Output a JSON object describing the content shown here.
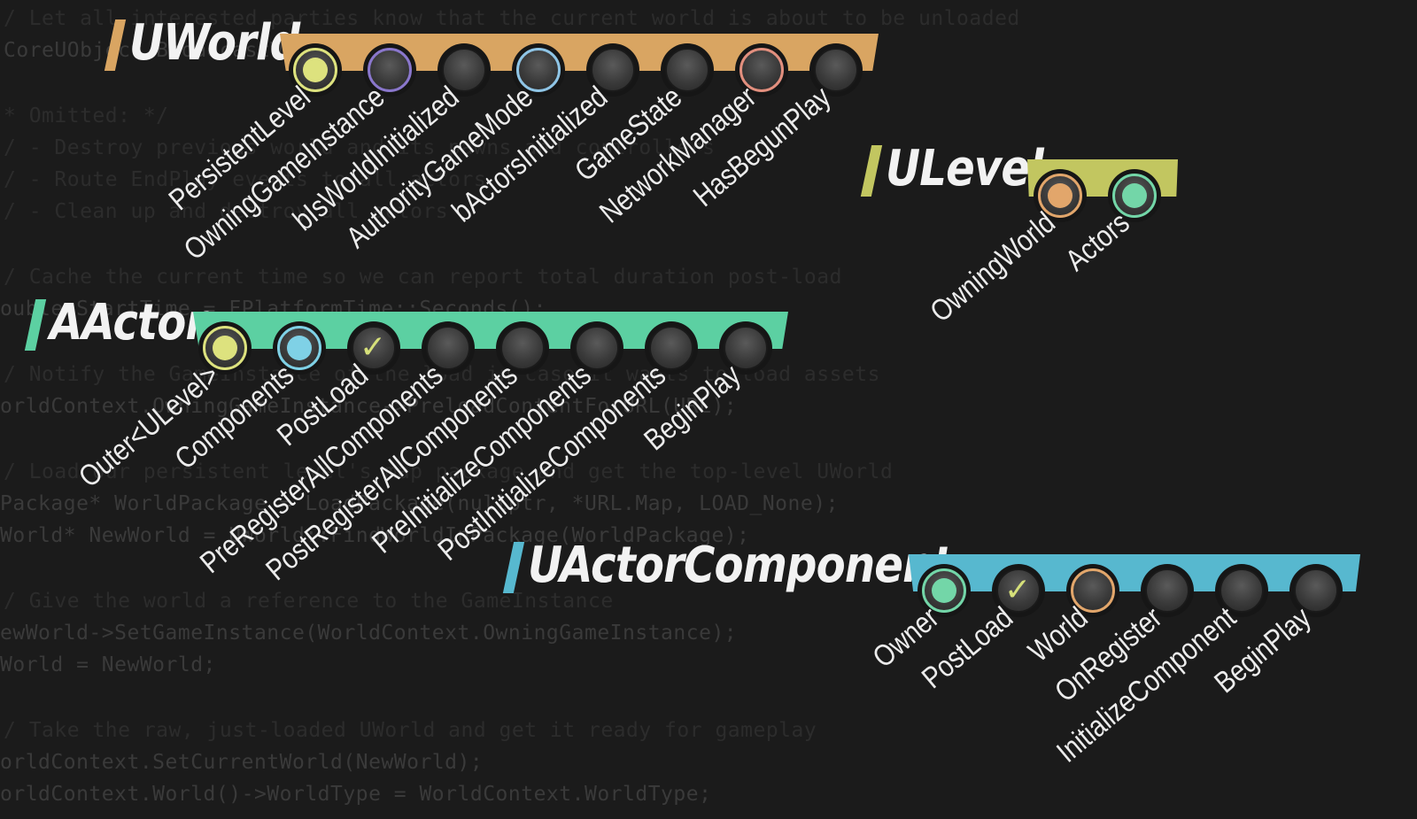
{
  "background_code": [
    "/ Let all interested parties know that the current world is about to be unloaded",
    "CoreUObject.BroadcastWorldCleanup(Map, ...);",
    "* Omitted: */",
    "/ - Destroy previous world and its pawns and controllers",
    "/ - Route EndPlay events to all actors",
    "/ - Clean up and destroy all actors",
    "/ Cache the current time so we can report total duration post-load",
    "ouble StartTime = FPlatformTime::Seconds();",
    "/ Notify the GameInstance of the load in case it wants to load assets",
    "orldContext.OwningGameInstance->PreloadContentForURL(URL);",
    "/ Load our persistent level's map package and get the top-level UWorld",
    "Package* WorldPackage = LoadPackage(nullptr, *URL.Map, LOAD_None);",
    "World* NewWorld = UWorld::FindWorldInPackage(WorldPackage);",
    "/ Give the world a reference to the GameInstance",
    "ewWorld->SetGameInstance(WorldContext.OwningGameInstance);",
    "World = NewWorld;",
    "/ Take the raw, just-loaded UWorld and get it ready for gameplay",
    "orldContext.SetCurrentWorld(NewWorld);",
    "orldContext.World()->WorldType = WorldContext.WorldType;"
  ],
  "colors": {
    "uworld": "#d9a562",
    "ulevel": "#c2c660",
    "aactor": "#5cd0a2",
    "uactorcomponent": "#57b8cf",
    "yellow_fill": "#dde27e",
    "purple_ring": "#8a77cc",
    "blue_ring": "#8fc5e6",
    "salmon_ring": "#e28f7e",
    "orange_fill": "#e2a66b",
    "green_fill": "#73d6a8",
    "cyan_fill": "#7fd1e6",
    "check": "#d6e07a"
  },
  "panels": {
    "uworld": {
      "title": "UWorld",
      "fields": [
        {
          "label": "PersistentLevel",
          "state": "filled",
          "color": "yellow_fill"
        },
        {
          "label": "OwningGameInstance",
          "state": "ring",
          "color": "purple_ring"
        },
        {
          "label": "bIsWorldInitialized",
          "state": "empty"
        },
        {
          "label": "AuthorityGameMode",
          "state": "ring",
          "color": "blue_ring"
        },
        {
          "label": "bActorsInitialized",
          "state": "empty"
        },
        {
          "label": "GameState",
          "state": "empty"
        },
        {
          "label": "NetworkManager",
          "state": "ring",
          "color": "salmon_ring"
        },
        {
          "label": "HasBegunPlay",
          "state": "empty"
        }
      ]
    },
    "ulevel": {
      "title": "ULevel",
      "fields": [
        {
          "label": "OwningWorld",
          "state": "filled",
          "color": "orange_fill"
        },
        {
          "label": "Actors",
          "state": "filled",
          "color": "green_fill"
        }
      ]
    },
    "aactor": {
      "title": "AActor",
      "fields": [
        {
          "label": "Outer<ULevel>",
          "state": "filled",
          "color": "yellow_fill"
        },
        {
          "label": "Components",
          "state": "filled",
          "color": "cyan_fill"
        },
        {
          "label": "PostLoad",
          "state": "check"
        },
        {
          "label": "PreRegisterAllComponents",
          "state": "empty"
        },
        {
          "label": "PostRegisterAllComponents",
          "state": "empty"
        },
        {
          "label": "PreInitializeComponents",
          "state": "empty"
        },
        {
          "label": "PostInitializeComponents",
          "state": "empty"
        },
        {
          "label": "BeginPlay",
          "state": "empty"
        }
      ]
    },
    "uactorcomponent": {
      "title": "UActorComponent",
      "fields": [
        {
          "label": "Owner",
          "state": "filled",
          "color": "green_fill"
        },
        {
          "label": "PostLoad",
          "state": "check"
        },
        {
          "label": "World",
          "state": "ring",
          "color": "orange_fill"
        },
        {
          "label": "OnRegister",
          "state": "empty"
        },
        {
          "label": "InitializeComponent",
          "state": "empty"
        },
        {
          "label": "BeginPlay",
          "state": "empty"
        }
      ]
    }
  },
  "check_glyph": "✓"
}
